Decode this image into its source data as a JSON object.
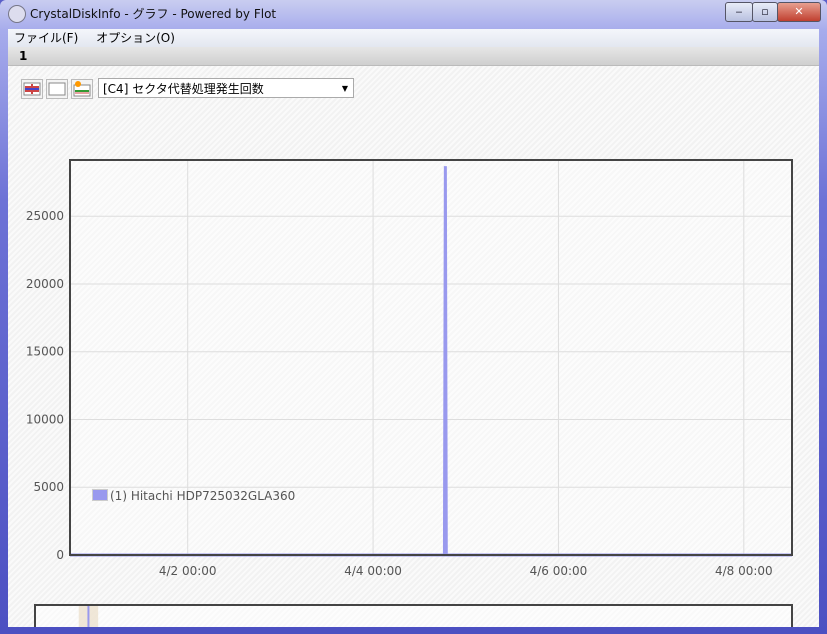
{
  "window": {
    "title": "CrystalDiskInfo - グラフ - Powered by Flot",
    "minimize": "‒",
    "maximize": "▫",
    "close": "✕"
  },
  "menu": [
    "ファイル(F)",
    "オプション(O)"
  ],
  "tab": "1",
  "toolbar": {
    "icons": [
      "all-disks-icon",
      "blank-icon",
      "new-chart-icon"
    ],
    "attribute_select": "[C4] セクタ代替処理発生回数"
  },
  "colors": {
    "series": "#9999ee",
    "grid": "#dddddd",
    "border": "#444444"
  },
  "chart_data": {
    "type": "line",
    "title": "",
    "xlabel": "",
    "ylabel": "",
    "x_ticks": [
      "4/2 00:00",
      "4/4 00:00",
      "4/6 00:00",
      "4/8 00:00"
    ],
    "x_range_days": [
      -1.27,
      6.52
    ],
    "y_ticks": [
      0,
      5000,
      10000,
      15000,
      20000,
      25000
    ],
    "ylim": [
      0,
      29150
    ],
    "grid": true,
    "legend": {
      "position": "bottom-left",
      "entries": [
        "(1) Hitachi HDP725032GLA360"
      ]
    },
    "series": [
      {
        "name": "(1) Hitachi HDP725032GLA360",
        "points": [
          [
            -1.27,
            0
          ],
          [
            2.77,
            0
          ],
          [
            2.78,
            28700
          ],
          [
            2.79,
            0
          ],
          [
            6.52,
            0
          ]
        ]
      }
    ],
    "overview": {
      "selection_days": [
        -0.82,
        -0.62
      ]
    }
  }
}
